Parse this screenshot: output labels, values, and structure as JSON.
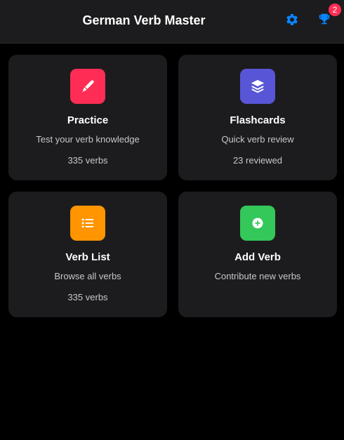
{
  "header": {
    "title": "German Verb Master",
    "settings_icon": "gear-icon",
    "trophy_icon": "trophy-icon",
    "notification_count": "2"
  },
  "colors": {
    "accent": "#0a84ff",
    "badge": "#ff2d55",
    "practice": "#ff2d55",
    "flashcards": "#5856d6",
    "verb_list": "#ff9500",
    "add_verb": "#34c759"
  },
  "cards": [
    {
      "icon": "pen-icon",
      "title": "Practice",
      "description": "Test your verb knowledge",
      "stat": "335 verbs"
    },
    {
      "icon": "layers-icon",
      "title": "Flashcards",
      "description": "Quick verb review",
      "stat": "23 reviewed"
    },
    {
      "icon": "list-icon",
      "title": "Verb List",
      "description": "Browse all verbs",
      "stat": "335 verbs"
    },
    {
      "icon": "plus-circle-icon",
      "title": "Add Verb",
      "description": "Contribute new verbs",
      "stat": ""
    }
  ]
}
